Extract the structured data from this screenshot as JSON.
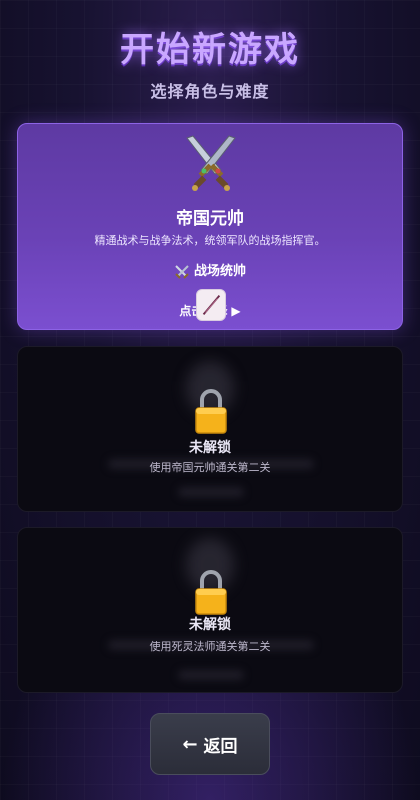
{
  "header": {
    "title": "开始新游戏",
    "subtitle": "选择角色与难度"
  },
  "cards": [
    {
      "state": "unlocked",
      "icon": "crossed-swords-icon",
      "name": "帝国元帅",
      "description": "精通战术与战争法术，统领军队的战场指挥官。",
      "tag_icon": "crossed-swords-icon",
      "tag": "战场统帅",
      "hint": "点击选择",
      "hint_icon": "play-triangle-icon"
    },
    {
      "state": "locked",
      "icon": "lock-icon",
      "title": "未解锁",
      "requirement": "使用帝国元帅通关第二关"
    },
    {
      "state": "locked",
      "icon": "lock-icon",
      "title": "未解锁",
      "requirement": "使用死灵法师通关第二关"
    }
  ],
  "footer": {
    "back_label": "返回",
    "back_icon": "arrow-left-icon"
  },
  "colors": {
    "title": "#c9a7ff",
    "active_card": "#6a42b6",
    "locked_card": "#0b0a12",
    "lock": "#f5b21b"
  }
}
